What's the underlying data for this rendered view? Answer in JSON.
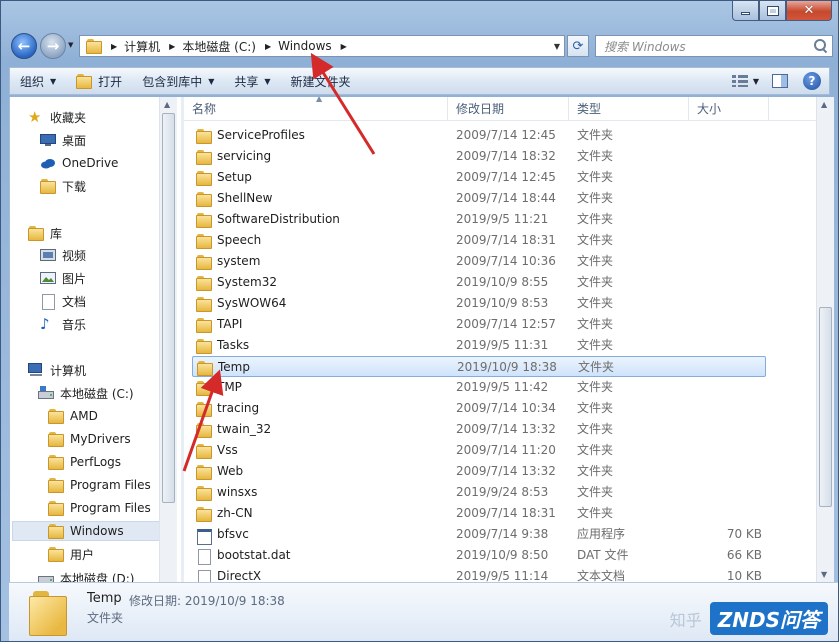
{
  "address": {
    "crumbs": [
      "计算机",
      "本地磁盘 (C:)",
      "Windows"
    ]
  },
  "search": {
    "placeholder": "搜索 Windows"
  },
  "toolbar": {
    "organize": "组织",
    "open": "打开",
    "include_library": "包含到库中",
    "share": "共享",
    "new_folder": "新建文件夹"
  },
  "sidebar": {
    "favorites": "收藏夹",
    "desktop": "桌面",
    "onedrive": "OneDrive",
    "downloads": "下载",
    "libraries": "库",
    "videos": "视频",
    "pictures": "图片",
    "documents": "文档",
    "music": "音乐",
    "computer": "计算机",
    "local_disk_c": "本地磁盘 (C:)",
    "folders": [
      "AMD",
      "MyDrivers",
      "PerfLogs",
      "Program Files",
      "Program Files",
      "Windows",
      "用户"
    ],
    "local_disk_d": "本地磁盘 (D:)"
  },
  "columns": {
    "name": "名称",
    "date": "修改日期",
    "type": "类型",
    "size": "大小"
  },
  "files": [
    {
      "name": "ServiceProfiles",
      "date": "2009/7/14 12:45",
      "type": "文件夹",
      "size": "",
      "icon": "folder"
    },
    {
      "name": "servicing",
      "date": "2009/7/14 18:32",
      "type": "文件夹",
      "size": "",
      "icon": "folder"
    },
    {
      "name": "Setup",
      "date": "2009/7/14 12:45",
      "type": "文件夹",
      "size": "",
      "icon": "folder"
    },
    {
      "name": "ShellNew",
      "date": "2009/7/14 18:44",
      "type": "文件夹",
      "size": "",
      "icon": "folder"
    },
    {
      "name": "SoftwareDistribution",
      "date": "2019/9/5 11:21",
      "type": "文件夹",
      "size": "",
      "icon": "folder"
    },
    {
      "name": "Speech",
      "date": "2009/7/14 18:31",
      "type": "文件夹",
      "size": "",
      "icon": "folder"
    },
    {
      "name": "system",
      "date": "2009/7/14 10:36",
      "type": "文件夹",
      "size": "",
      "icon": "folder"
    },
    {
      "name": "System32",
      "date": "2019/10/9 8:55",
      "type": "文件夹",
      "size": "",
      "icon": "folder"
    },
    {
      "name": "SysWOW64",
      "date": "2019/10/9 8:53",
      "type": "文件夹",
      "size": "",
      "icon": "folder"
    },
    {
      "name": "TAPI",
      "date": "2009/7/14 12:57",
      "type": "文件夹",
      "size": "",
      "icon": "folder"
    },
    {
      "name": "Tasks",
      "date": "2019/9/5 11:31",
      "type": "文件夹",
      "size": "",
      "icon": "folder"
    },
    {
      "name": "Temp",
      "date": "2019/10/9 18:38",
      "type": "文件夹",
      "size": "",
      "icon": "folder"
    },
    {
      "name": "TMP",
      "date": "2019/9/5 11:42",
      "type": "文件夹",
      "size": "",
      "icon": "folder"
    },
    {
      "name": "tracing",
      "date": "2009/7/14 10:34",
      "type": "文件夹",
      "size": "",
      "icon": "folder"
    },
    {
      "name": "twain_32",
      "date": "2009/7/14 13:32",
      "type": "文件夹",
      "size": "",
      "icon": "folder"
    },
    {
      "name": "Vss",
      "date": "2009/7/14 11:20",
      "type": "文件夹",
      "size": "",
      "icon": "folder"
    },
    {
      "name": "Web",
      "date": "2009/7/14 13:32",
      "type": "文件夹",
      "size": "",
      "icon": "folder"
    },
    {
      "name": "winsxs",
      "date": "2019/9/24 8:53",
      "type": "文件夹",
      "size": "",
      "icon": "folder"
    },
    {
      "name": "zh-CN",
      "date": "2009/7/14 18:31",
      "type": "文件夹",
      "size": "",
      "icon": "folder"
    },
    {
      "name": "bfsvc",
      "date": "2009/7/14 9:38",
      "type": "应用程序",
      "size": "70 KB",
      "icon": "exe"
    },
    {
      "name": "bootstat.dat",
      "date": "2019/10/9 8:50",
      "type": "DAT 文件",
      "size": "66 KB",
      "icon": "doc"
    },
    {
      "name": "DirectX",
      "date": "2019/9/5 11:14",
      "type": "文本文档",
      "size": "10 KB",
      "icon": "doc"
    }
  ],
  "selected_index": 11,
  "details": {
    "name": "Temp",
    "modified": "修改日期: 2019/10/9 18:38",
    "type": "文件夹"
  },
  "watermark": {
    "zhihu": "知乎",
    "znds": "ZNDS问答"
  },
  "colors": {
    "accent": "#1e73c8",
    "arrow": "#d42a2a",
    "selection": "#cfe3fb"
  }
}
